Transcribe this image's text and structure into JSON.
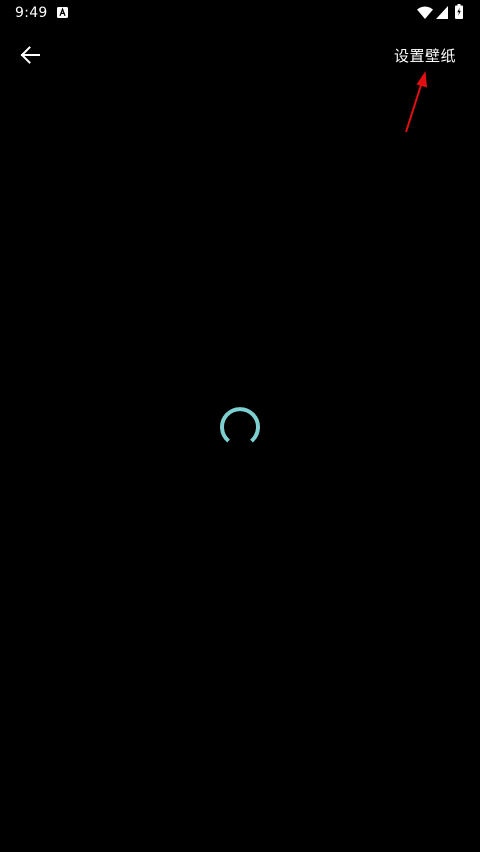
{
  "status_bar": {
    "time": "9:49",
    "icons": [
      "notification-a-icon",
      "wifi-icon",
      "signal-icon",
      "battery-charging-icon"
    ]
  },
  "toolbar": {
    "back_icon": "arrow-left-icon",
    "set_wallpaper_label": "设置壁纸"
  },
  "content": {
    "loading_indicator": "spinner-icon",
    "spinner_color": "#7ecfcf"
  },
  "annotation": {
    "arrow_color": "#e01010"
  },
  "colors": {
    "background": "#000000",
    "text": "#ffffff"
  }
}
